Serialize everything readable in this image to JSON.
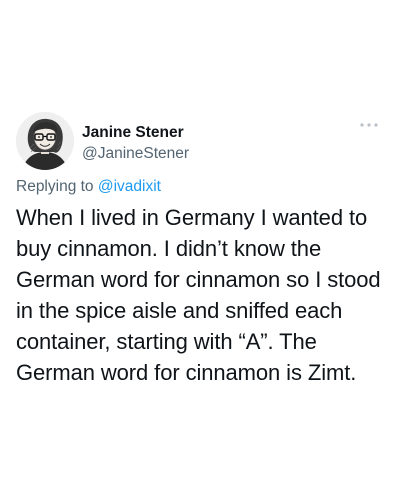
{
  "tweet": {
    "author": {
      "display_name": "Janine Stener",
      "handle": "@JanineStener",
      "avatar_icon": "cartoon-portrait-avatar"
    },
    "more_icon": "more-options-icon",
    "reply": {
      "prefix": "Replying to",
      "mention": "@ivadixit"
    },
    "text": "When I lived in Germany I wanted to buy cinnamon. I didn’t know the German word for cinnamon so I stood in the spice aisle and sniffed each container, starting with “A”. The German word for cinnamon is Zimt."
  },
  "colors": {
    "primary_text": "#0f1419",
    "secondary_text": "#536471",
    "link": "#1d9bf0",
    "background": "#ffffff"
  }
}
